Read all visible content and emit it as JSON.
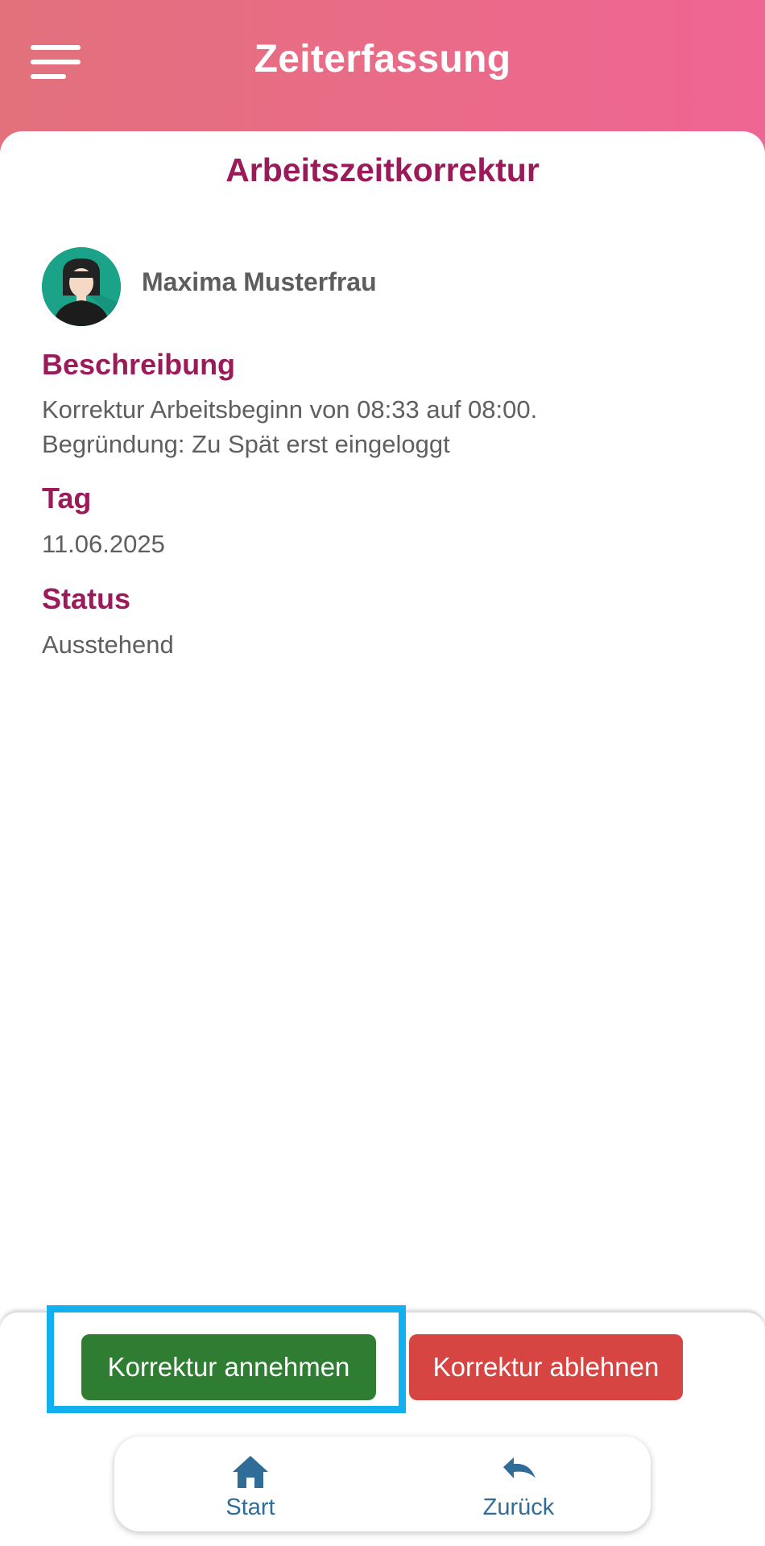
{
  "header": {
    "title": "Zeiterfassung",
    "menu_icon": "hamburger-menu-icon"
  },
  "page": {
    "title": "Arbeitszeitkorrektur"
  },
  "user": {
    "name": "Maxima Musterfrau",
    "avatar_icon": "user-avatar-icon"
  },
  "details": {
    "description_label": "Beschreibung",
    "description_line1": "Korrektur Arbeitsbeginn von 08:33 auf 08:00.",
    "description_line2": "Begründung: Zu Spät erst eingeloggt",
    "day_label": "Tag",
    "day_value": "11.06.2025",
    "status_label": "Status",
    "status_value": "Ausstehend"
  },
  "actions": {
    "accept_label": "Korrektur annehmen",
    "reject_label": "Korrektur ablehnen"
  },
  "bottom_nav": {
    "items": [
      {
        "label": "Start",
        "icon": "home-icon"
      },
      {
        "label": "Zurück",
        "icon": "undo-arrow-icon"
      }
    ]
  },
  "colors": {
    "header_gradient_start": "#e2717c",
    "header_gradient_end": "#ef6593",
    "accent": "#9b1b5a",
    "accept": "#2e7d32",
    "reject": "#d64541",
    "highlight": "#12b0ef",
    "nav": "#2f6d98"
  }
}
